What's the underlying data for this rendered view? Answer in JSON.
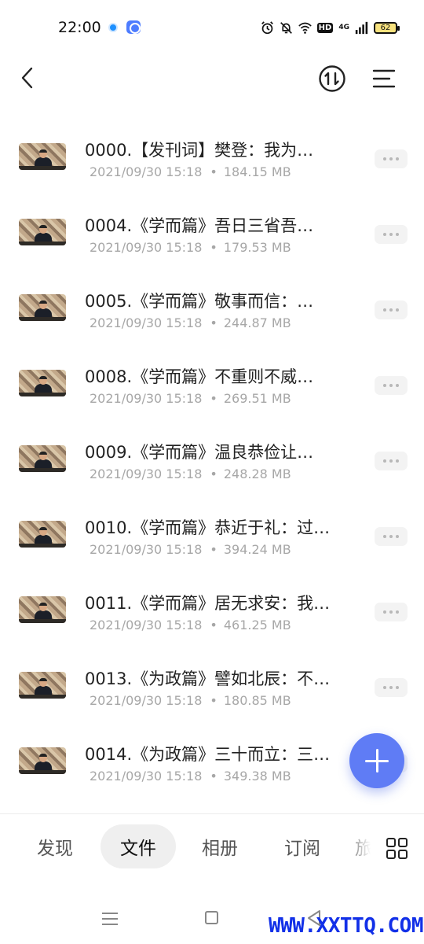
{
  "status_bar": {
    "time": "22:00",
    "icons": [
      "app-notification-icon",
      "camera-app-icon",
      "alarm-icon",
      "mute-icon",
      "wifi-icon"
    ],
    "hd_label": "HD",
    "network": "4G",
    "battery": "62"
  },
  "header": {
    "back_icon": "chevron-left-icon",
    "sort_icon": "sort-icon",
    "menu_icon": "menu-icon"
  },
  "files": [
    {
      "title": "0000.【发刊词】樊登：我为…",
      "date": "2021/09/30 15:18",
      "size": "184.15 MB"
    },
    {
      "title": "0004.《学而篇》吾日三省吾…",
      "date": "2021/09/30 15:18",
      "size": "179.53 MB"
    },
    {
      "title": "0005.《学而篇》敬事而信：…",
      "date": "2021/09/30 15:18",
      "size": "244.87 MB"
    },
    {
      "title": "0008.《学而篇》不重则不威…",
      "date": "2021/09/30 15:18",
      "size": "269.51 MB"
    },
    {
      "title": "0009.《学而篇》温良恭俭让…",
      "date": "2021/09/30 15:18",
      "size": "248.28 MB"
    },
    {
      "title": "0010.《学而篇》恭近于礼：过…",
      "date": "2021/09/30 15:18",
      "size": "394.24 MB"
    },
    {
      "title": "0011.《学而篇》居无求安：我…",
      "date": "2021/09/30 15:18",
      "size": "461.25 MB"
    },
    {
      "title": "0013.《为政篇》譬如北辰：不…",
      "date": "2021/09/30 15:18",
      "size": "180.85 MB"
    },
    {
      "title": "0014.《为政篇》三十而立：三…",
      "date": "2021/09/30 15:18",
      "size": "349.38 MB"
    }
  ],
  "fab": {
    "icon": "plus-icon"
  },
  "tabs": [
    {
      "label": "发现",
      "active": false
    },
    {
      "label": "文件",
      "active": true
    },
    {
      "label": "相册",
      "active": false
    },
    {
      "label": "订阅",
      "active": false
    },
    {
      "label": "旅",
      "active": false
    }
  ],
  "grid_icon": "grid-icon",
  "system_nav": {
    "icons": [
      "nav-menu-icon",
      "nav-home-icon",
      "nav-back-icon"
    ]
  },
  "watermark": "WWW.XXTTQ.COM"
}
